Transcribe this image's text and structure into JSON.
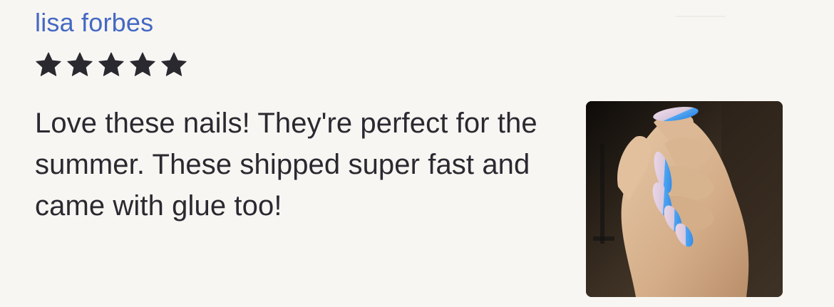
{
  "review": {
    "reviewer_name": "lisa forbes",
    "rating": 5,
    "rating_max": 5,
    "text": "Love these nails! They're perfect for the summer. These shipped super fast and came with glue too!"
  },
  "icons": {
    "star": "star-icon",
    "photo": "review-photo"
  },
  "colors": {
    "background": "#f8f6f2",
    "name_link": "#4469c4",
    "star": "#2b2930",
    "body_text": "#2b2930"
  }
}
